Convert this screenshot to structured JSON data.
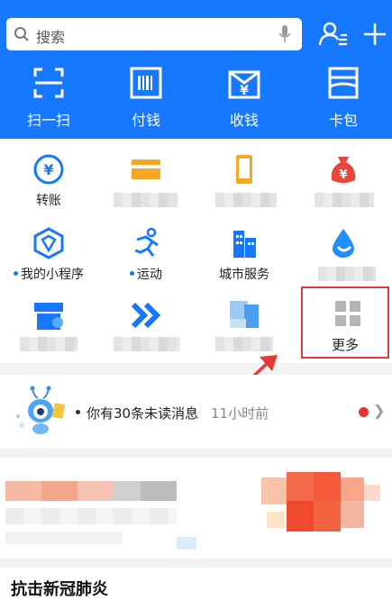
{
  "search": {
    "placeholder": "搜索"
  },
  "quick_actions": [
    {
      "label": "扫一扫",
      "icon": "scan-icon"
    },
    {
      "label": "付钱",
      "icon": "pay-icon"
    },
    {
      "label": "收钱",
      "icon": "receive-icon"
    },
    {
      "label": "卡包",
      "icon": "card-wallet-icon"
    }
  ],
  "grid": {
    "transfer": "转账",
    "mini_program": "我的小程序",
    "sports": "运动",
    "city_service": "城市服务",
    "more": "更多"
  },
  "message": {
    "text": "你有30条未读消息",
    "time": "11小时前"
  },
  "section": {
    "title": "抗击新冠肺炎"
  },
  "colors": {
    "brand": "#1677ff",
    "highlight": "#e53935",
    "badge": "#e8332b"
  }
}
